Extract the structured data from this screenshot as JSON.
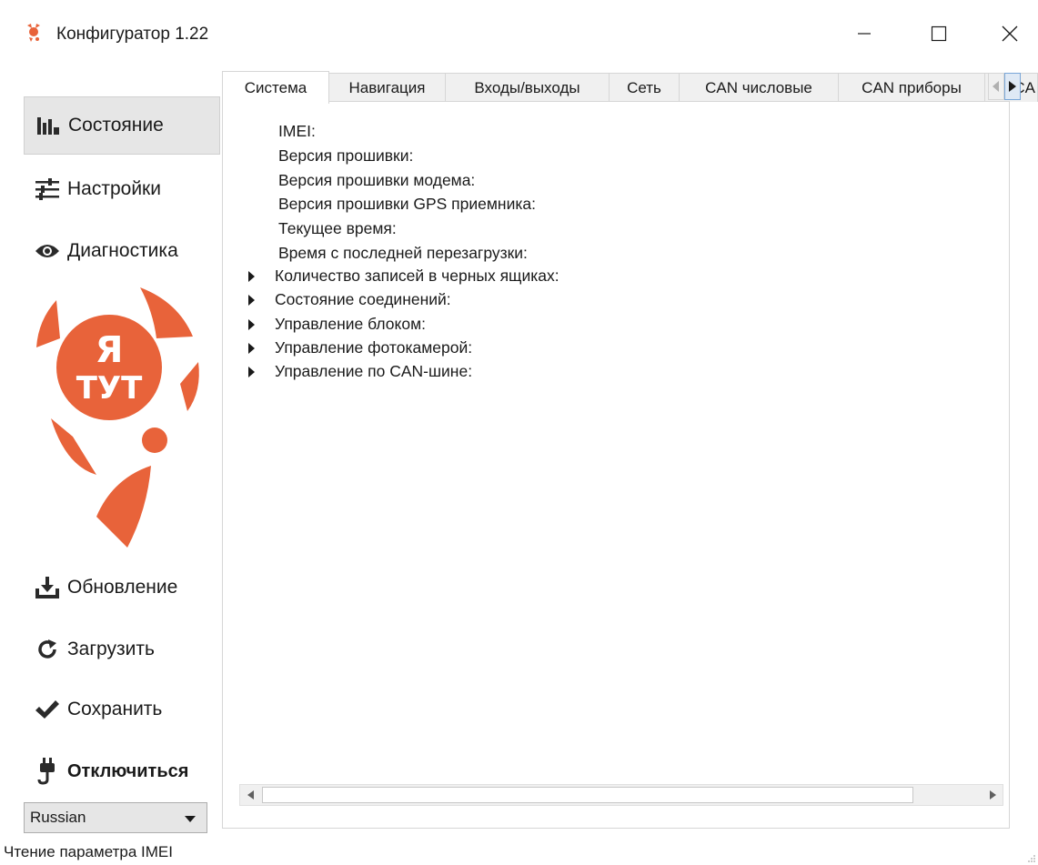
{
  "window": {
    "title": "Конфигуратор 1.22",
    "icon": "app-logo-icon",
    "controls": [
      "minimize-icon",
      "maximize-icon",
      "close-icon"
    ]
  },
  "sidebar": {
    "status": "Состояние",
    "settings": "Настройки",
    "diagnostics": "Диагностика",
    "update": "Обновление",
    "load": "Загрузить",
    "save": "Сохранить",
    "disconnect": "Отключиться",
    "logo_text_1": "Я",
    "logo_text_2": "ТУТ",
    "language": "Russian"
  },
  "tabs": [
    {
      "label": "Система",
      "active": true
    },
    {
      "label": "Навигация"
    },
    {
      "label": "Входы/выходы"
    },
    {
      "label": "Сеть"
    },
    {
      "label": "CAN числовые"
    },
    {
      "label": "CAN приборы"
    },
    {
      "label": "CA"
    }
  ],
  "system": {
    "fields": [
      "IMEI:",
      "Версия прошивки:",
      "Версия прошивки модема:",
      "Версия прошивки GPS приемника:",
      "Текущее время:",
      "Время с последней перезагрузки:"
    ],
    "tree": [
      "Количество записей в черных ящиках:",
      "Состояние соединений:",
      "Управление блоком:",
      "Управление фотокамерой:",
      "Управление по CAN-шине:"
    ]
  },
  "statusbar": {
    "text": "Чтение параметра IMEI"
  },
  "colors": {
    "accent": "#e8633a",
    "active_bg": "#e6e6e6",
    "tab_bg": "#f0f0f0",
    "border": "#d6d6d6"
  }
}
